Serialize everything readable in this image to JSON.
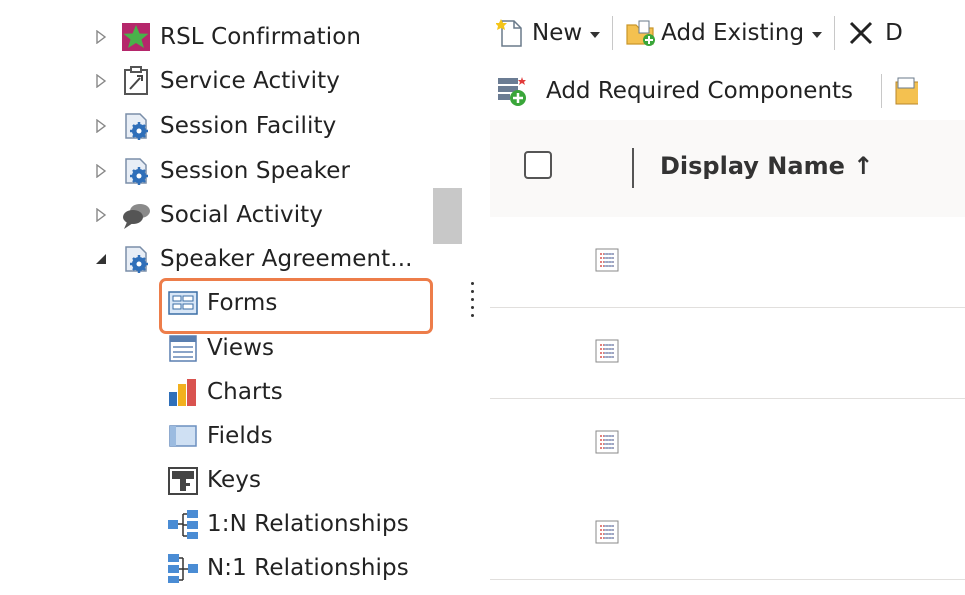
{
  "tree": {
    "items": [
      {
        "label": "RSL Confirmation",
        "icon": "star-icon",
        "expand": "collapsed"
      },
      {
        "label": "Service Activity",
        "icon": "service-activity-icon",
        "expand": "collapsed"
      },
      {
        "label": "Session Facility",
        "icon": "entity-gear-icon",
        "expand": "collapsed"
      },
      {
        "label": "Session Speaker",
        "icon": "entity-gear-icon",
        "expand": "collapsed"
      },
      {
        "label": "Social Activity",
        "icon": "social-activity-icon",
        "expand": "collapsed"
      },
      {
        "label": "Speaker Agreement...",
        "icon": "entity-gear-icon",
        "expand": "expanded"
      }
    ],
    "children": [
      {
        "label": "Forms",
        "icon": "form-icon"
      },
      {
        "label": "Views",
        "icon": "view-icon"
      },
      {
        "label": "Charts",
        "icon": "chart-icon"
      },
      {
        "label": "Fields",
        "icon": "field-icon"
      },
      {
        "label": "Keys",
        "icon": "key-icon"
      },
      {
        "label": "1:N Relationships",
        "icon": "one-to-many-icon"
      },
      {
        "label": "N:1 Relationships",
        "icon": "many-to-one-icon"
      }
    ]
  },
  "toolbar": {
    "new_label": "New",
    "add_existing_label": "Add Existing",
    "delete_label": "D",
    "add_required_label": "Add Required Components"
  },
  "grid": {
    "column_header": "Display Name ↑",
    "rows": [
      "",
      "",
      "",
      ""
    ]
  },
  "colors": {
    "highlight": "#ed7d4a",
    "star": "#49b24a",
    "star_bg": "#b5276b"
  }
}
